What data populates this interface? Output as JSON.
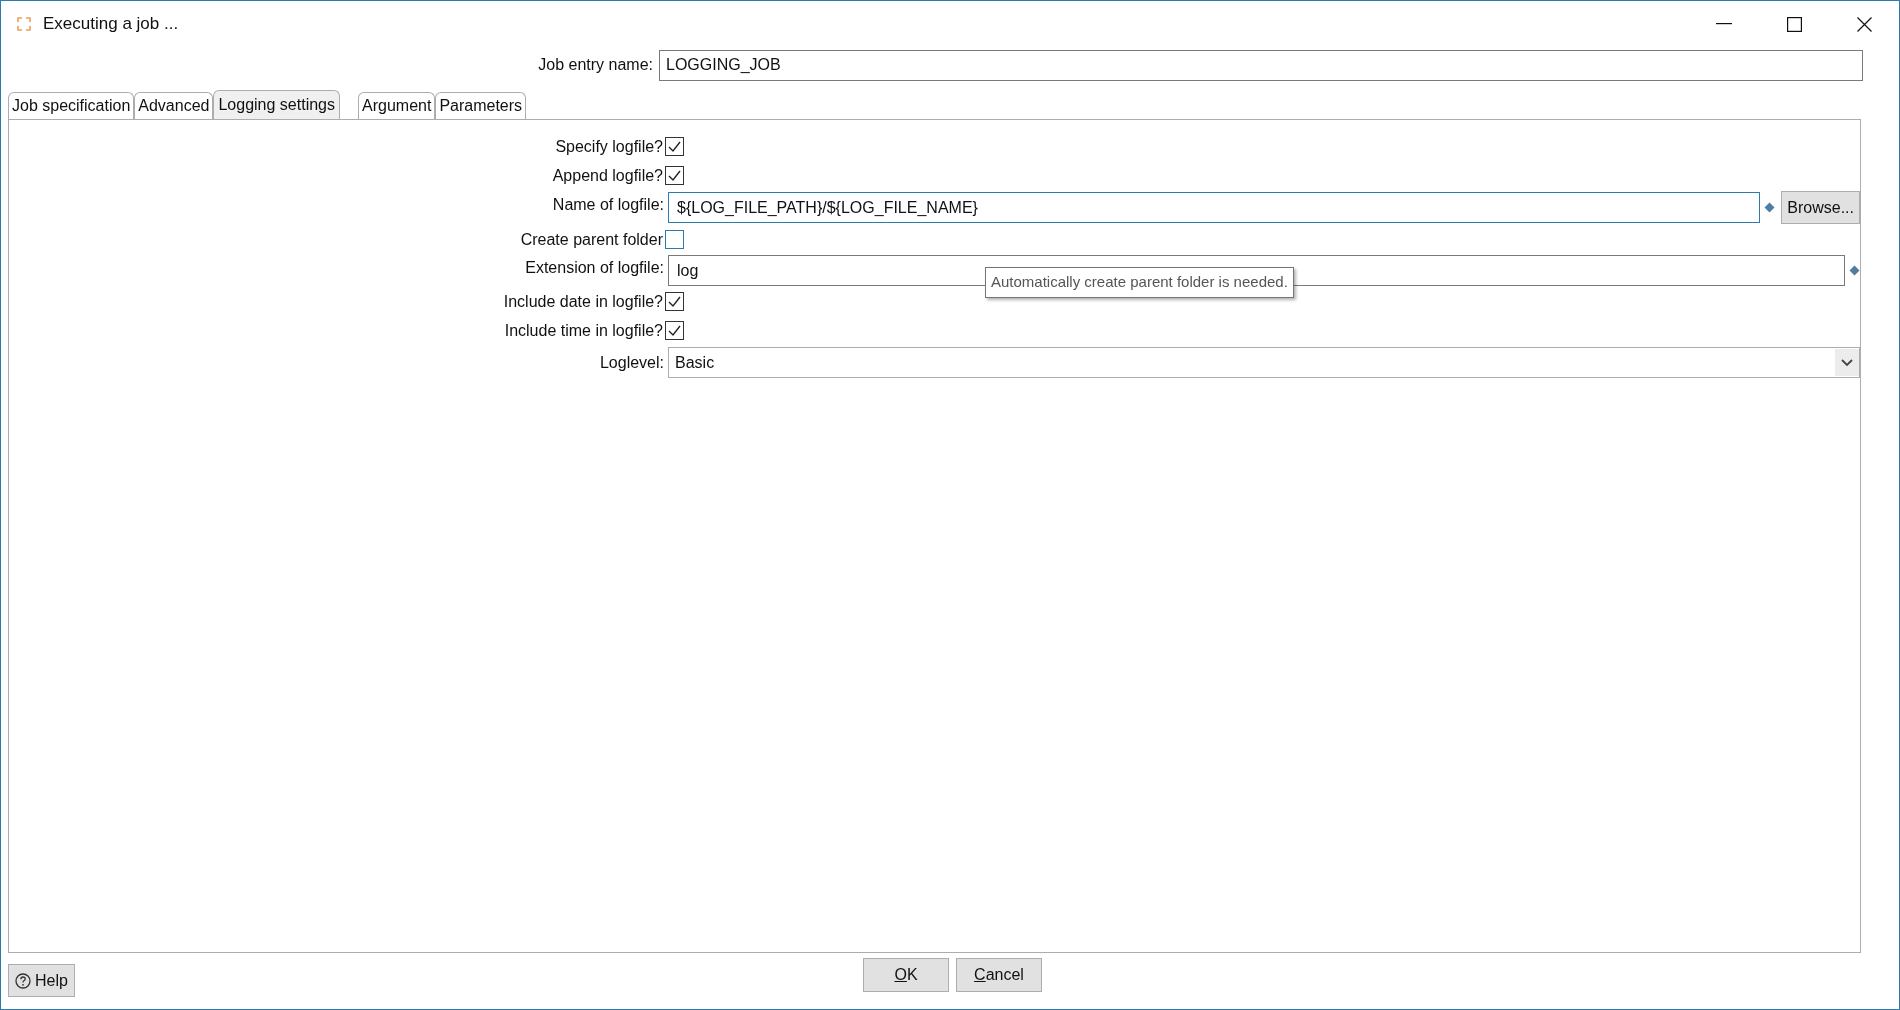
{
  "window": {
    "title": "Executing a job ..."
  },
  "job_entry": {
    "label": "Job entry name:",
    "value": "LOGGING_JOB"
  },
  "tabs": [
    {
      "label": "Job specification",
      "selected": false
    },
    {
      "label": "Advanced",
      "selected": false
    },
    {
      "label": "Logging settings",
      "selected": true
    },
    {
      "label": "Argument",
      "selected": false
    },
    {
      "label": "Parameters",
      "selected": false
    }
  ],
  "form": [
    {
      "kind": "checkbox",
      "label": "Specify logfile?",
      "checked": true
    },
    {
      "kind": "checkbox",
      "label": "Append logfile?",
      "checked": true
    },
    {
      "kind": "text",
      "label": "Name of logfile:",
      "value": "${LOG_FILE_PATH}/${LOG_FILE_NAME}",
      "focused": true,
      "button": "Browse..."
    },
    {
      "kind": "checkbox",
      "label": "Create parent folder",
      "checked": false
    },
    {
      "kind": "text",
      "label": "Extension of logfile:",
      "value": "log",
      "focused": false
    },
    {
      "kind": "checkbox",
      "label": "Include date in logfile?",
      "checked": true
    },
    {
      "kind": "checkbox",
      "label": "Include time in logfile?",
      "checked": true
    },
    {
      "kind": "select",
      "label": "Loglevel:",
      "value": "Basic"
    }
  ],
  "tooltip": "Automatically create parent folder is needed.",
  "footer": {
    "help": "Help",
    "buttons": [
      {
        "label": "OK",
        "underline_first": true
      },
      {
        "label": "Cancel",
        "underline_first": true
      }
    ]
  }
}
